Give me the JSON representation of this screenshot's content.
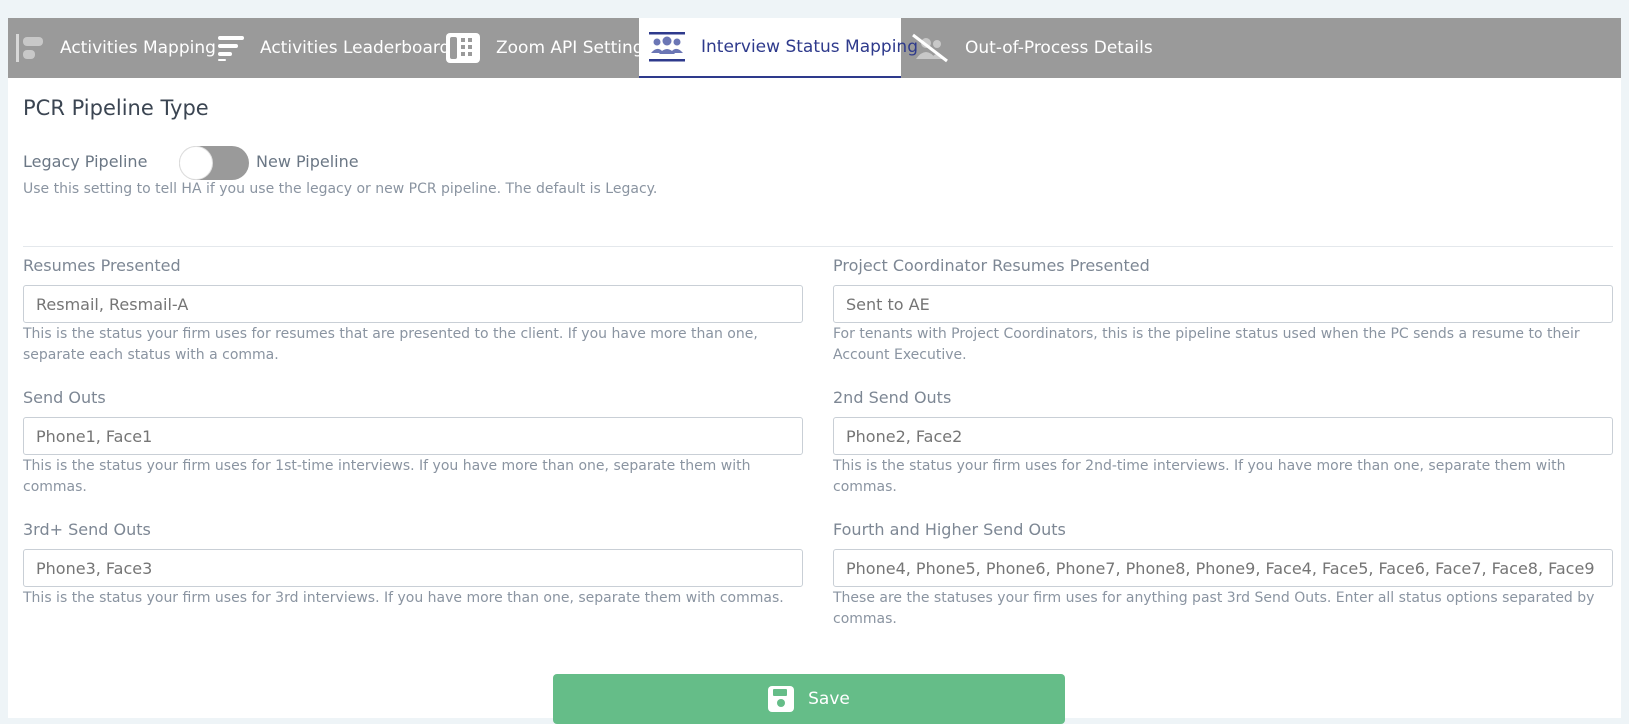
{
  "tabs": [
    {
      "label": "Activities Mapping",
      "icon": "bar-chart-icon"
    },
    {
      "label": "Activities Leaderboard",
      "icon": "leaderboard-icon"
    },
    {
      "label": "Zoom API Settings",
      "icon": "phone-icon"
    },
    {
      "label": "Interview Status Mapping",
      "icon": "users-icon",
      "active": true
    },
    {
      "label": "Out-of-Process Details",
      "icon": "users-slash-icon"
    }
  ],
  "pipeline": {
    "title": "PCR Pipeline Type",
    "legacy_label": "Legacy Pipeline",
    "new_label": "New Pipeline",
    "help": "Use this setting to tell HA if you use the legacy or new PCR pipeline. The default is Legacy."
  },
  "fields": {
    "resumes_presented": {
      "label": "Resumes Presented",
      "placeholder": "Resmail, Resmail-A",
      "help": "This is the status your firm uses for resumes that are presented to the client. If you have more than one, separate each status with a comma."
    },
    "pc_resumes_presented": {
      "label": "Project Coordinator Resumes Presented",
      "placeholder": "Sent to AE",
      "help": "For tenants with Project Coordinators, this is the pipeline status used when the PC sends a resume to their Account Executive."
    },
    "send_outs": {
      "label": "Send Outs",
      "placeholder": "Phone1, Face1",
      "help": "This is the status your firm uses for 1st-time interviews. If you have more than one, separate them with commas."
    },
    "second_send_outs": {
      "label": "2nd Send Outs",
      "placeholder": "Phone2, Face2",
      "help": "This is the status your firm uses for 2nd-time interviews. If you have more than one, separate them with commas."
    },
    "third_send_outs": {
      "label": "3rd+ Send Outs",
      "placeholder": "Phone3, Face3",
      "help": "This is the status your firm uses for 3rd interviews. If you have more than one, separate them with commas."
    },
    "fourth_send_outs": {
      "label": "Fourth and Higher Send Outs",
      "placeholder": "Phone4, Phone5, Phone6, Phone7, Phone8, Phone9, Face4, Face5, Face6, Face7, Face8, Face9",
      "help": "These are the statuses your firm uses for anything past 3rd Send Outs. Enter all status options separated by commas."
    }
  },
  "save_label": "Save",
  "colors": {
    "tabbar": "#9a9a9a",
    "active_tab": "#2e3a8c",
    "save_button": "#65bd88"
  }
}
